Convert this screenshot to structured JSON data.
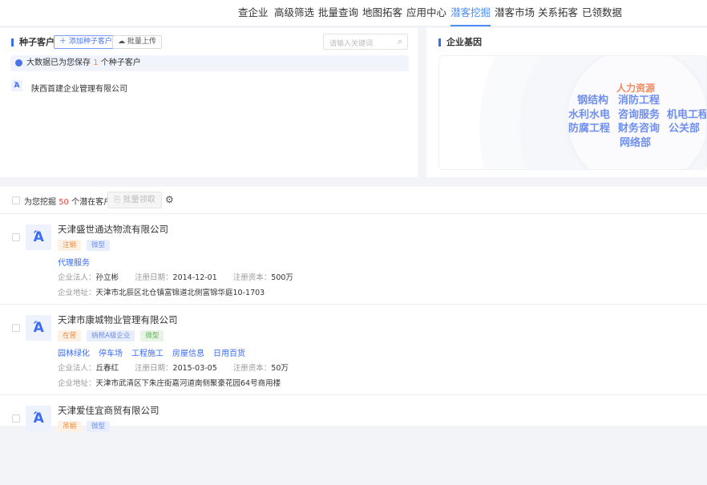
{
  "nav": {
    "items": [
      "查企业",
      "高级筛选",
      "批量查询",
      "地图拓客",
      "应用中心",
      "潜客挖掘",
      "潜客市场",
      "关系拓客",
      "已领数据"
    ],
    "active": 5
  },
  "seed": {
    "title": "种子客户",
    "add_label": "添加种子客户",
    "upload_label": "批量上传",
    "search_placeholder": "请输入关键词",
    "notice_prefix": "大数据已为您保存",
    "notice_count": "1",
    "notice_suffix": "个种子客户",
    "companies": [
      "陕西首建企业管理有限公司"
    ]
  },
  "gene": {
    "title": "企业基因",
    "highlight": "人力资源",
    "words": [
      "钢结构",
      "消防工程",
      "水利水电",
      "咨询服务",
      "机电工程",
      "防腐工程",
      "财务咨询",
      "公关部",
      "网络部"
    ]
  },
  "list": {
    "prefix": "为您挖掘",
    "count": "50",
    "suffix": "个潜在客户",
    "batch_label": "批量领取",
    "rows": [
      {
        "name": "天津盛世通达物流有限公司",
        "tags": [
          {
            "text": "注销",
            "c": "orange"
          },
          {
            "text": "微型",
            "c": "blue"
          }
        ],
        "links": [
          "代理服务"
        ],
        "legal_label": "企业法人：",
        "legal": "孙立彬",
        "date_label": "注册日期：",
        "date": "2014-12-01",
        "cap_label": "注册资本：",
        "cap": "500万",
        "addr_label": "企业地址：",
        "addr": "天津市北辰区北仓镇富锦道北侧富锦华庭10-1703"
      },
      {
        "name": "天津市康城物业管理有限公司",
        "tags": [
          {
            "text": "在营",
            "c": "orange"
          },
          {
            "text": "纳税A级企业",
            "c": "blue"
          },
          {
            "text": "微型",
            "c": "green"
          }
        ],
        "links": [
          "园林绿化",
          "停车场",
          "工程施工",
          "房屋信息",
          "日用百货"
        ],
        "legal_label": "企业法人：",
        "legal": "丘春红",
        "date_label": "注册日期：",
        "date": "2015-03-05",
        "cap_label": "注册资本：",
        "cap": "50万",
        "addr_label": "企业地址：",
        "addr": "天津市武清区下朱庄街嘉河道南侧聚豪花园64号商用楼"
      },
      {
        "name": "天津爱佳宜商贸有限公司",
        "tags": [
          {
            "text": "吊销",
            "c": "orange"
          },
          {
            "text": "微型",
            "c": "blue"
          }
        ]
      }
    ]
  },
  "colors": {
    "accent": "#3a6cf4",
    "nav_active": "#4a8ef5",
    "count": "#e5413a",
    "highlight": "#f58a5e"
  }
}
